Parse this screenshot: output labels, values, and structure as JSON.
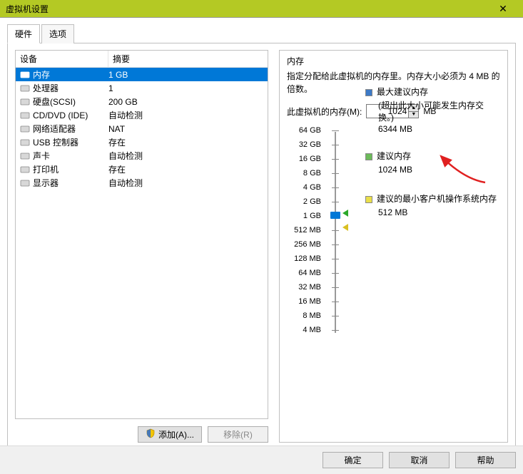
{
  "window": {
    "title": "虚拟机设置"
  },
  "tabs": {
    "hardware": "硬件",
    "options": "选项"
  },
  "list": {
    "headers": {
      "device": "设备",
      "summary": "摘要"
    },
    "rows": [
      {
        "name": "内存",
        "summary": "1 GB",
        "iconColor": "#2aa82a",
        "selected": true
      },
      {
        "name": "处理器",
        "summary": "1",
        "iconColor": "#888"
      },
      {
        "name": "硬盘(SCSI)",
        "summary": "200 GB",
        "iconColor": "#888"
      },
      {
        "name": "CD/DVD (IDE)",
        "summary": "自动检测",
        "iconColor": "#888"
      },
      {
        "name": "网络适配器",
        "summary": "NAT",
        "iconColor": "#4a7"
      },
      {
        "name": "USB 控制器",
        "summary": "存在",
        "iconColor": "#666"
      },
      {
        "name": "声卡",
        "summary": "自动检测",
        "iconColor": "#666"
      },
      {
        "name": "打印机",
        "summary": "存在",
        "iconColor": "#666"
      },
      {
        "name": "显示器",
        "summary": "自动检测",
        "iconColor": "#555"
      }
    ]
  },
  "buttons": {
    "add": "添加(A)...",
    "remove": "移除(R)"
  },
  "memory": {
    "title": "内存",
    "description": "指定分配给此虚拟机的内存里。内存大小必须为 4 MB 的倍数。",
    "label": "此虚拟机的内存(M):",
    "value": "1024",
    "unit": "MB",
    "ticks": [
      "64 GB",
      "32 GB",
      "16 GB",
      "8 GB",
      "4 GB",
      "2 GB",
      "1 GB",
      "512 MB",
      "256 MB",
      "128 MB",
      "64 MB",
      "32 MB",
      "16 MB",
      "8 MB",
      "4 MB"
    ],
    "legend": {
      "max": {
        "title": "最大建议内存",
        "note": "(超出此大小可能发生内存交换。)",
        "value": "6344 MB",
        "color": "#3d7ac7"
      },
      "rec": {
        "title": "建议内存",
        "value": "1024 MB",
        "color": "#6cbb5a"
      },
      "min": {
        "title": "建议的最小客户机操作系统内存",
        "value": "512 MB",
        "color": "#eadf4a"
      }
    }
  },
  "footer": {
    "ok": "确定",
    "cancel": "取消",
    "help": "帮助"
  }
}
